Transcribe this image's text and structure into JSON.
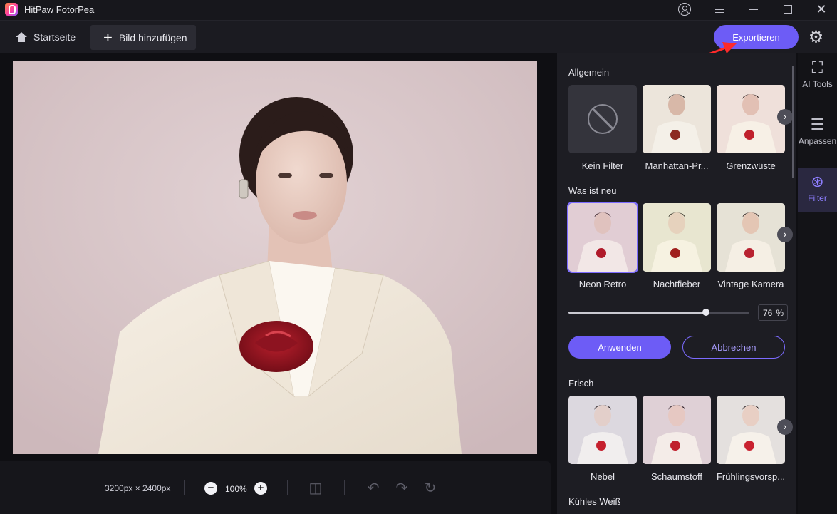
{
  "app": {
    "title": "HitPaw FotorPea"
  },
  "toolbar": {
    "home_label": "Startseite",
    "add_label": "Bild hinzufügen",
    "export_label": "Exportieren"
  },
  "canvas": {
    "dimensions": "3200px × 2400px",
    "zoom": "100%"
  },
  "filters": {
    "sections": [
      {
        "title": "Allgemein",
        "items": [
          "Kein Filter",
          "Manhattan-Pr...",
          "Grenzwüste"
        ]
      },
      {
        "title": "Was ist neu",
        "items": [
          "Neon Retro",
          "Nachtfieber",
          "Vintage Kamera"
        ]
      },
      {
        "title": "Frisch",
        "items": [
          "Nebel",
          "Schaumstoff",
          "Frühlingsvorsp..."
        ]
      },
      {
        "title": "Kühles Weiß",
        "items": []
      }
    ],
    "selected": "Neon Retro",
    "intensity": {
      "value": "76",
      "unit": "%",
      "fraction": 0.76
    },
    "apply_label": "Anwenden",
    "cancel_label": "Abbrechen"
  },
  "rail": [
    {
      "label": "AI Tools",
      "icon": "ai-tools-icon"
    },
    {
      "label": "Anpassen",
      "icon": "sliders-icon"
    },
    {
      "label": "Filter",
      "icon": "filter-circles-icon",
      "active": true
    }
  ],
  "colors": {
    "accent": "#6d5cf6",
    "background": "#0f0f13",
    "panel": "#1d1d23"
  }
}
